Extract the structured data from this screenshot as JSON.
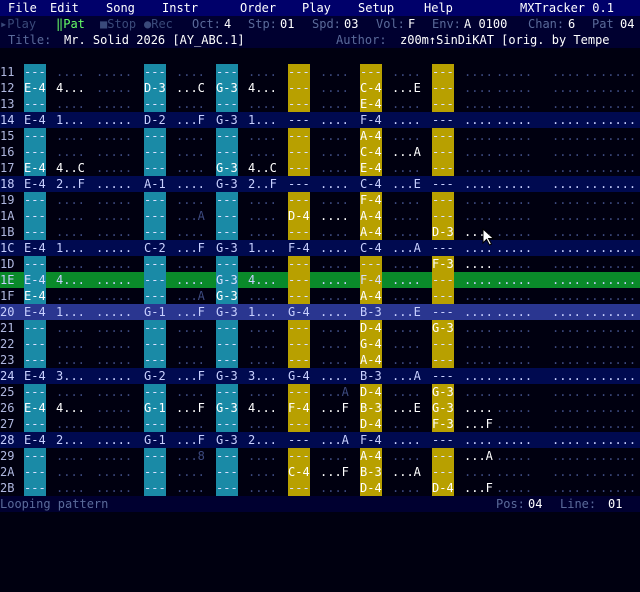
{
  "menu": {
    "items": [
      "File",
      "Edit",
      "Song",
      "Instr",
      "Order",
      "Play",
      "Setup",
      "Help"
    ],
    "app_title": "MXTracker 0.1"
  },
  "status": {
    "play": "▸Play",
    "pat": "‖Pat",
    "stop": "■Stop",
    "rec": "●Rec",
    "oct_label": "Oct:",
    "oct": "4",
    "stp_label": "Stp:",
    "stp": "01",
    "spd_label": "Spd:",
    "spd": "03",
    "vol_label": "Vol:",
    "vol": "F",
    "env_label": "Env:",
    "env": "A 0100",
    "chan_label": "Chan:",
    "chan": "6",
    "pat_label": "Pat",
    "pat_num": "04"
  },
  "info": {
    "title_label": "Title:",
    "title": "Mr. Solid 2026 [AY_ABC.1]",
    "author_label": "Author:",
    "author": "z00m↑SinDiKAT [orig. by Tempe"
  },
  "colors": {
    "menu_bg": "#00006a",
    "highlight_row": "#000a50",
    "cursor_row": "#0a8a2a",
    "selected_row": "#2a3690",
    "cyan_note": "#1a8aa6",
    "yellow_note": "#b8a000"
  },
  "pattern": {
    "rows": [
      {
        "num": "11",
        "style": "",
        "c": [
          "---",
          "....",
          ".....",
          "---",
          "....",
          "---",
          "....",
          ".....",
          "---",
          "....",
          "---",
          "....",
          "---",
          "....",
          ".....",
          "....",
          "..",
          ".....",
          "....."
        ],
        "on": {
          "0": "c",
          "3": "c",
          "5": "c",
          "8": "y",
          "10": "y",
          "12": "y"
        }
      },
      {
        "num": "12",
        "style": "",
        "c": [
          "E-4",
          "4...",
          ".....",
          "D-3",
          "...C",
          "G-3",
          "4...",
          ".....",
          "---",
          "....",
          "C-4",
          "...E",
          "---",
          "....",
          ".....",
          "....",
          "..",
          ".....",
          "....."
        ],
        "on": {
          "0": "c",
          "3": "c",
          "5": "c",
          "8": "y",
          "10": "y",
          "12": "y"
        },
        "lit": [
          0,
          1,
          3,
          4,
          5,
          6,
          10,
          11
        ]
      },
      {
        "num": "13",
        "style": "",
        "c": [
          "---",
          "....",
          ".....",
          "---",
          "....",
          "---",
          "....",
          ".....",
          "---",
          "....",
          "E-4",
          "....",
          "---",
          "....",
          ".....",
          "....",
          "..",
          ".....",
          "....."
        ],
        "on": {
          "0": "c",
          "3": "c",
          "5": "c",
          "8": "y",
          "10": "y",
          "12": "y"
        },
        "lit": [
          10
        ]
      },
      {
        "num": "14",
        "style": "hl",
        "c": [
          "E-4",
          "1...",
          ".....",
          "D-2",
          "...F",
          "G-3",
          "1...",
          ".....",
          "---",
          "....",
          "F-4",
          "....",
          "---",
          "....",
          ".....",
          "....",
          "..",
          ".....",
          "....."
        ],
        "on": {}
      },
      {
        "num": "15",
        "style": "",
        "c": [
          "---",
          "....",
          ".....",
          "---",
          "....",
          "---",
          "....",
          ".....",
          "---",
          "....",
          "A-4",
          "....",
          "---",
          "....",
          ".....",
          "....",
          "..",
          ".....",
          "....."
        ],
        "on": {
          "0": "c",
          "3": "c",
          "5": "c",
          "8": "y",
          "10": "y",
          "12": "y"
        },
        "lit": [
          10
        ]
      },
      {
        "num": "16",
        "style": "",
        "c": [
          "---",
          "....",
          ".....",
          "---",
          "....",
          "---",
          "....",
          ".....",
          "---",
          "....",
          "C-4",
          "...A",
          "---",
          "....",
          ".....",
          "....",
          "..",
          ".....",
          "....."
        ],
        "on": {
          "0": "c",
          "3": "c",
          "5": "c",
          "8": "y",
          "10": "y",
          "12": "y"
        },
        "lit": [
          10,
          11
        ]
      },
      {
        "num": "17",
        "style": "",
        "c": [
          "E-4",
          "4..C",
          ".....",
          "---",
          "....",
          "G-3",
          "4..C",
          ".....",
          "---",
          "....",
          "E-4",
          "....",
          "---",
          "....",
          ".....",
          "....",
          "..",
          ".....",
          "....."
        ],
        "on": {
          "0": "c",
          "3": "c",
          "5": "c",
          "8": "y",
          "10": "y",
          "12": "y"
        },
        "lit": [
          0,
          1,
          5,
          6,
          10
        ]
      },
      {
        "num": "18",
        "style": "hl",
        "c": [
          "E-4",
          "2..F",
          ".....",
          "A-1",
          "....",
          "G-3",
          "2..F",
          ".....",
          "---",
          "....",
          "C-4",
          "...E",
          "---",
          "....",
          ".....",
          "....",
          "..",
          ".....",
          "....."
        ],
        "on": {}
      },
      {
        "num": "19",
        "style": "",
        "c": [
          "---",
          "....",
          ".....",
          "---",
          "....",
          "---",
          "....",
          ".....",
          "---",
          "....",
          "F-4",
          "....",
          "---",
          "....",
          ".....",
          "....",
          "..",
          ".....",
          "....."
        ],
        "on": {
          "0": "c",
          "3": "c",
          "5": "c",
          "8": "y",
          "10": "y",
          "12": "y"
        },
        "lit": [
          10
        ]
      },
      {
        "num": "1A",
        "style": "",
        "c": [
          "---",
          "....",
          ".....",
          "---",
          "...A",
          "---",
          "....",
          ".....",
          "D-4",
          "....",
          "A-4",
          "....",
          "---",
          "....",
          ".....",
          "....",
          "..",
          ".....",
          "....."
        ],
        "on": {
          "0": "c",
          "3": "c",
          "5": "c",
          "8": "y",
          "10": "y",
          "12": "y"
        },
        "lit": [
          8,
          9,
          10
        ]
      },
      {
        "num": "1B",
        "style": "",
        "c": [
          "---",
          "....",
          ".....",
          "---",
          "....",
          "---",
          "....",
          ".....",
          "---",
          "....",
          "A-4",
          "....",
          "D-3",
          "....",
          ".....",
          "....",
          "..",
          ".....",
          "....."
        ],
        "on": {
          "0": "c",
          "3": "c",
          "5": "c",
          "8": "y",
          "10": "y",
          "12": "y"
        },
        "lit": [
          10,
          12,
          13
        ]
      },
      {
        "num": "1C",
        "style": "hl",
        "c": [
          "E-4",
          "1...",
          ".....",
          "C-2",
          "...F",
          "G-3",
          "1...",
          ".....",
          "F-4",
          "....",
          "C-4",
          "...A",
          "---",
          "....",
          ".....",
          "....",
          "..",
          ".....",
          "....."
        ],
        "on": {}
      },
      {
        "num": "1D",
        "style": "",
        "c": [
          "---",
          "....",
          ".....",
          "---",
          "....",
          "---",
          "....",
          ".....",
          "---",
          "....",
          "---",
          "....",
          "F-3",
          "....",
          ".....",
          "....",
          "..",
          ".....",
          "....."
        ],
        "on": {
          "0": "c",
          "3": "c",
          "5": "c",
          "8": "y",
          "10": "y",
          "12": "y"
        },
        "lit": [
          12,
          13
        ]
      },
      {
        "num": "1E",
        "style": "cur",
        "c": [
          "E-4",
          "4...",
          ".....",
          "---",
          "....",
          "G-3",
          "4...",
          ".....",
          "---",
          "....",
          "F-4",
          "....",
          "---",
          "....",
          ".....",
          "....",
          "..",
          ".....",
          "....."
        ],
        "on": {
          "0": "c",
          "3": "c",
          "5": "c",
          "8": "y",
          "10": "y",
          "12": "y"
        }
      },
      {
        "num": "1F",
        "style": "",
        "c": [
          "E-4",
          "....",
          ".....",
          "---",
          "...A",
          "G-3",
          "....",
          ".....",
          "---",
          "....",
          "A-4",
          "....",
          "---",
          "....",
          ".....",
          "....",
          "..",
          ".....",
          "....."
        ],
        "on": {
          "0": "c",
          "3": "c",
          "5": "c",
          "8": "y",
          "10": "y",
          "12": "y"
        },
        "lit": [
          0,
          5,
          10
        ]
      },
      {
        "num": "20",
        "style": "sel",
        "c": [
          "E-4",
          "1...",
          ".....",
          "G-1",
          "...F",
          "G-3",
          "1...",
          ".....",
          "G-4",
          "....",
          "B-3",
          "...E",
          "---",
          "....",
          ".....",
          "....",
          "..",
          ".....",
          "....."
        ],
        "on": {}
      },
      {
        "num": "21",
        "style": "",
        "c": [
          "---",
          "....",
          ".....",
          "---",
          "....",
          "---",
          "....",
          ".....",
          "---",
          "....",
          "D-4",
          "....",
          "G-3",
          "....",
          ".....",
          "....",
          "..",
          ".....",
          "....."
        ],
        "on": {
          "0": "c",
          "3": "c",
          "5": "c",
          "8": "y",
          "10": "y",
          "12": "y"
        },
        "lit": [
          10,
          12
        ]
      },
      {
        "num": "22",
        "style": "",
        "c": [
          "---",
          "....",
          ".....",
          "---",
          "....",
          "---",
          "....",
          ".....",
          "---",
          "....",
          "G-4",
          "....",
          "---",
          "....",
          ".....",
          "....",
          "..",
          ".....",
          "....."
        ],
        "on": {
          "0": "c",
          "3": "c",
          "5": "c",
          "8": "y",
          "10": "y",
          "12": "y"
        },
        "lit": [
          10
        ]
      },
      {
        "num": "23",
        "style": "",
        "c": [
          "---",
          "....",
          ".....",
          "---",
          "....",
          "---",
          "....",
          ".....",
          "---",
          "....",
          "A-4",
          "....",
          "---",
          "....",
          ".....",
          "....",
          "..",
          ".....",
          "....."
        ],
        "on": {
          "0": "c",
          "3": "c",
          "5": "c",
          "8": "y",
          "10": "y",
          "12": "y"
        },
        "lit": [
          10
        ]
      },
      {
        "num": "24",
        "style": "hl",
        "c": [
          "E-4",
          "3...",
          ".....",
          "G-2",
          "...F",
          "G-3",
          "3...",
          ".....",
          "G-4",
          "....",
          "B-3",
          "...A",
          "---",
          "....",
          ".....",
          "....",
          "..",
          ".....",
          "....."
        ],
        "on": {}
      },
      {
        "num": "25",
        "style": "",
        "c": [
          "---",
          "....",
          ".....",
          "---",
          "....",
          "---",
          "....",
          ".....",
          "---",
          "...A",
          "D-4",
          "....",
          "G-3",
          "....",
          ".....",
          "....",
          "..",
          ".....",
          "....."
        ],
        "on": {
          "0": "c",
          "3": "c",
          "5": "c",
          "8": "y",
          "10": "y",
          "12": "y"
        },
        "lit": [
          10,
          12
        ]
      },
      {
        "num": "26",
        "style": "",
        "c": [
          "E-4",
          "4...",
          ".....",
          "G-1",
          "...F",
          "G-3",
          "4...",
          ".....",
          "F-4",
          "...F",
          "B-3",
          "...E",
          "G-3",
          "....",
          ".....",
          "....",
          "..",
          ".....",
          "....."
        ],
        "on": {
          "0": "c",
          "3": "c",
          "5": "c",
          "8": "y",
          "10": "y",
          "12": "y"
        },
        "lit": [
          0,
          1,
          3,
          4,
          5,
          6,
          8,
          9,
          10,
          11,
          12,
          13
        ]
      },
      {
        "num": "27",
        "style": "",
        "c": [
          "---",
          "....",
          ".....",
          "---",
          "....",
          "---",
          "....",
          ".....",
          "---",
          "....",
          "D-4",
          "....",
          "F-3",
          "...F",
          ".....",
          "....",
          "..",
          ".....",
          "....."
        ],
        "on": {
          "0": "c",
          "3": "c",
          "5": "c",
          "8": "y",
          "10": "y",
          "12": "y"
        },
        "lit": [
          10,
          12,
          13
        ]
      },
      {
        "num": "28",
        "style": "hl",
        "c": [
          "E-4",
          "2...",
          ".....",
          "G-1",
          "...F",
          "G-3",
          "2...",
          ".....",
          "---",
          "...A",
          "F-4",
          "....",
          "---",
          "....",
          ".....",
          "....",
          "..",
          ".....",
          "....."
        ],
        "on": {}
      },
      {
        "num": "29",
        "style": "",
        "c": [
          "---",
          "....",
          ".....",
          "---",
          "...8",
          "---",
          "....",
          ".....",
          "---",
          "....",
          "A-4",
          "....",
          "---",
          "...A",
          ".....",
          "....",
          "..",
          ".....",
          "....."
        ],
        "on": {
          "0": "c",
          "3": "c",
          "5": "c",
          "8": "y",
          "10": "y",
          "12": "y"
        },
        "lit": [
          10,
          13
        ]
      },
      {
        "num": "2A",
        "style": "",
        "c": [
          "---",
          "....",
          ".....",
          "---",
          "....",
          "---",
          "....",
          ".....",
          "C-4",
          "...F",
          "B-3",
          "...A",
          "---",
          "....",
          ".....",
          "....",
          "..",
          ".....",
          "....."
        ],
        "on": {
          "0": "c",
          "3": "c",
          "5": "c",
          "8": "y",
          "10": "y",
          "12": "y"
        },
        "lit": [
          8,
          9,
          10,
          11
        ]
      },
      {
        "num": "2B",
        "style": "",
        "c": [
          "---",
          "....",
          ".....",
          "---",
          "....",
          "---",
          "....",
          ".....",
          "---",
          "....",
          "D-4",
          "....",
          "D-4",
          "...F",
          ".....",
          "....",
          "..",
          ".....",
          "....."
        ],
        "on": {
          "0": "c",
          "3": "c",
          "5": "c",
          "8": "y",
          "10": "y",
          "12": "y"
        },
        "lit": [
          10,
          12,
          13
        ]
      }
    ]
  },
  "footer": {
    "message": "Looping pattern",
    "pos_label": "Pos:",
    "pos": "04",
    "line_label": "Line:",
    "line": "01"
  },
  "cursor": {
    "icon": "mouse-pointer-icon"
  }
}
